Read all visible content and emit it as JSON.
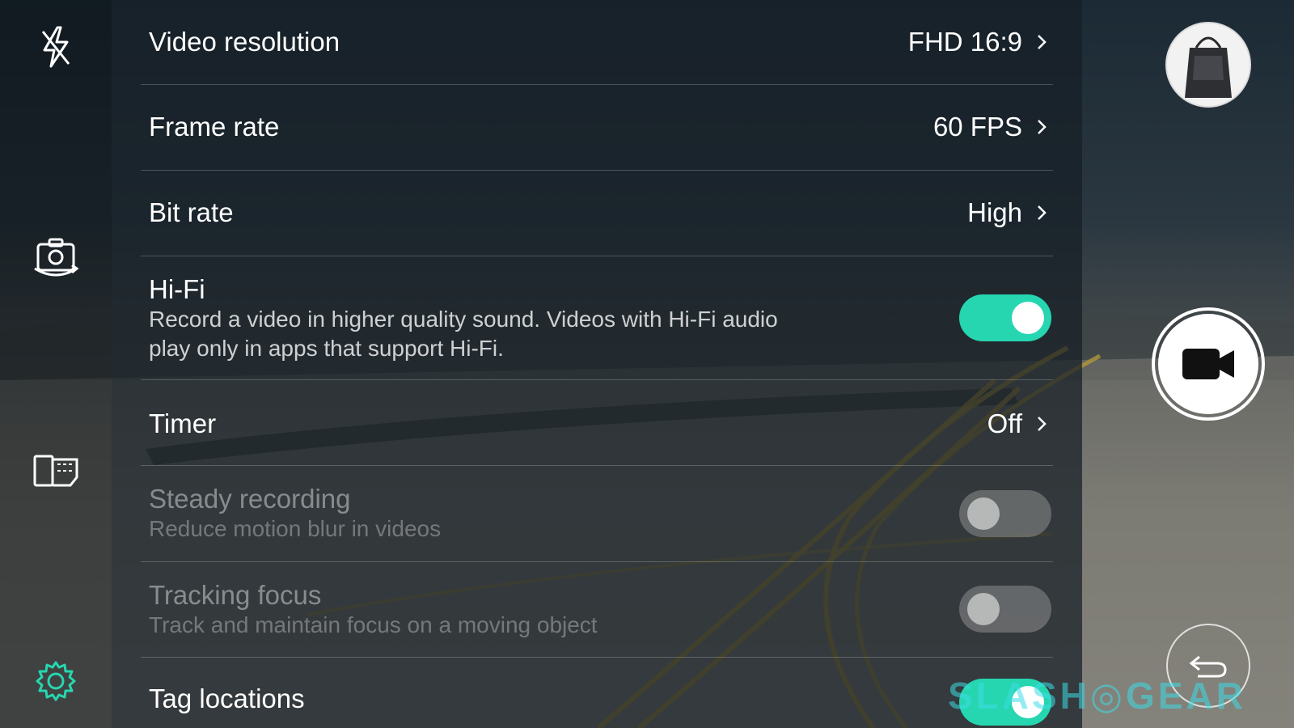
{
  "colors": {
    "accent": "#26d6b0",
    "panel_background": "#161e26",
    "divider": "#5a6168",
    "toggle_off": "#969696",
    "settings_icon": "#26d6b0"
  },
  "left_rail": {
    "flash_icon": "flash-off-icon",
    "switch_camera_icon": "switch-camera-icon",
    "storage_icon": "storage-card-icon",
    "settings_icon": "gear-icon"
  },
  "settings": {
    "video_resolution": {
      "label": "Video resolution",
      "value": "FHD 16:9"
    },
    "frame_rate": {
      "label": "Frame rate",
      "value": "60 FPS"
    },
    "bit_rate": {
      "label": "Bit rate",
      "value": "High"
    },
    "hifi": {
      "label": "Hi-Fi",
      "desc_line1": "Record a video in higher quality sound. Videos with Hi-Fi audio",
      "desc_line2": "play only in apps that support Hi-Fi.",
      "enabled": true
    },
    "timer": {
      "label": "Timer",
      "value": "Off"
    },
    "steady_recording": {
      "label": "Steady recording",
      "desc": "Reduce motion blur in videos",
      "enabled": false,
      "disabled": true
    },
    "tracking_focus": {
      "label": "Tracking focus",
      "desc": "Track and maintain focus on a moving object",
      "enabled": false,
      "disabled": true
    },
    "tag_locations": {
      "label": "Tag locations",
      "enabled": true
    }
  },
  "right_rail": {
    "gallery_thumbnail_icon": "gallery-thumbnail",
    "record_icon": "video-camera-icon",
    "back_icon": "back-arrow-icon"
  },
  "watermark": "SLASH◎GEAR"
}
